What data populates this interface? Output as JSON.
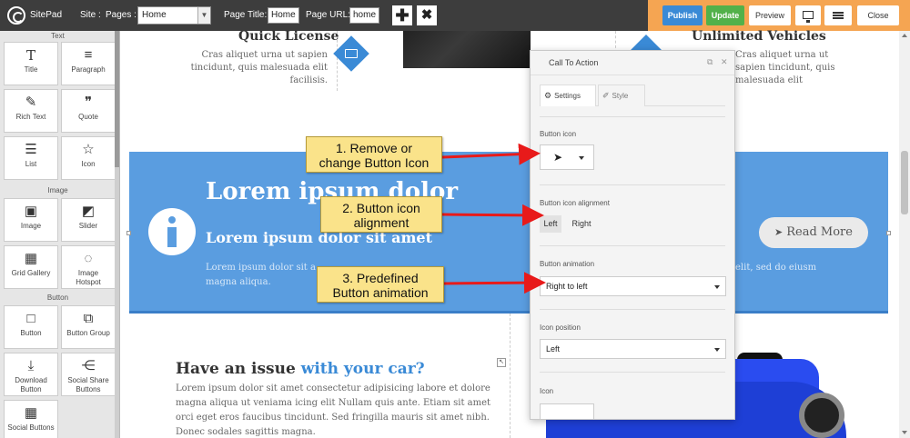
{
  "topbar": {
    "app_name": "SitePad",
    "site_label": "Site :",
    "pages_label": "Pages :",
    "pages_value": "Home",
    "page_title_label": "Page Title:",
    "page_title_value": "Home",
    "page_url_label": "Page URL:",
    "page_url_value": "home",
    "add_glyph": "✚",
    "delete_glyph": "✖",
    "publish": "Publish",
    "update": "Update",
    "preview": "Preview",
    "close": "Close"
  },
  "left_panel": {
    "sections": [
      "Text",
      "Image",
      "Button"
    ],
    "widgets": [
      {
        "label": "Title",
        "icon": "T"
      },
      {
        "label": "Paragraph",
        "icon": "≡"
      },
      {
        "label": "Rich Text",
        "icon": "✎"
      },
      {
        "label": "Quote",
        "icon": "❞"
      },
      {
        "label": "List",
        "icon": "☰"
      },
      {
        "label": "Icon",
        "icon": "☆"
      },
      {
        "label": "Image",
        "icon": "▣"
      },
      {
        "label": "Slider",
        "icon": "◩"
      },
      {
        "label": "Grid Gallery",
        "icon": "▦"
      },
      {
        "label": "Image Hotspot",
        "icon": "◌"
      },
      {
        "label": "Button",
        "icon": "□"
      },
      {
        "label": "Button Group",
        "icon": "⧉"
      },
      {
        "label": "Download Button",
        "icon": "⤓"
      },
      {
        "label": "Social Share Buttons",
        "icon": "⋲"
      },
      {
        "label": "Social Buttons",
        "icon": "▦"
      }
    ]
  },
  "main": {
    "quick_license_title": "Quick License",
    "quick_license_text": "Cras aliquet urna ut sapien tincidunt, quis malesuada elit facilisis.",
    "unlimited_title": "Unlimited Vehicles",
    "unlimited_text": "Cras aliquet urna ut sapien tincidunt, quis malesuada elit",
    "banner_h1": "Lorem ipsum dolor",
    "banner_h2": "Lorem ipsum dolor sit amet",
    "banner_p_line1": "Lorem ipsum dolor sit a",
    "banner_p_line1_end": "elit, sed do eiusm",
    "banner_p_line2": "magna aliqua.",
    "read_more": "Read More",
    "issue_title": "Have an issue",
    "issue_title_accent": "with your car?",
    "issue_text": "Lorem ipsum dolor sit amet consectetur adipisicing labore et dolore magna aliqua ut veniama icing elit Nullam quis ante. Etiam sit amet orci eget eros faucibus tincidunt. Sed fringilla mauris sit amet nibh. Donec sodales sagittis magna."
  },
  "cta_panel": {
    "title": "Call To Action",
    "tab_settings": "Settings",
    "tab_style": "Style",
    "button_icon_label": "Button icon",
    "alignment_label": "Button icon alignment",
    "align_left": "Left",
    "align_right": "Right",
    "animation_label": "Button animation",
    "animation_value": "Right to left",
    "icon_position_label": "Icon position",
    "icon_position_value": "Left",
    "icon_label": "Icon"
  },
  "callouts": {
    "c1_line1": "1. Remove or",
    "c1_line2": "change Button Icon",
    "c2_line1": "2. Button icon",
    "c2_line2": "alignment",
    "c3_line1": "3. Predefined",
    "c3_line2": "Button animation"
  },
  "colors": {
    "topbar": "#3d3d3d",
    "orange": "#f5a552",
    "publish": "#3a8ad6",
    "update": "#52b14a",
    "banner": "#5a9de0",
    "accent": "#3a8ad6",
    "callout": "#fae38a",
    "arrow": "#e81a1a"
  }
}
